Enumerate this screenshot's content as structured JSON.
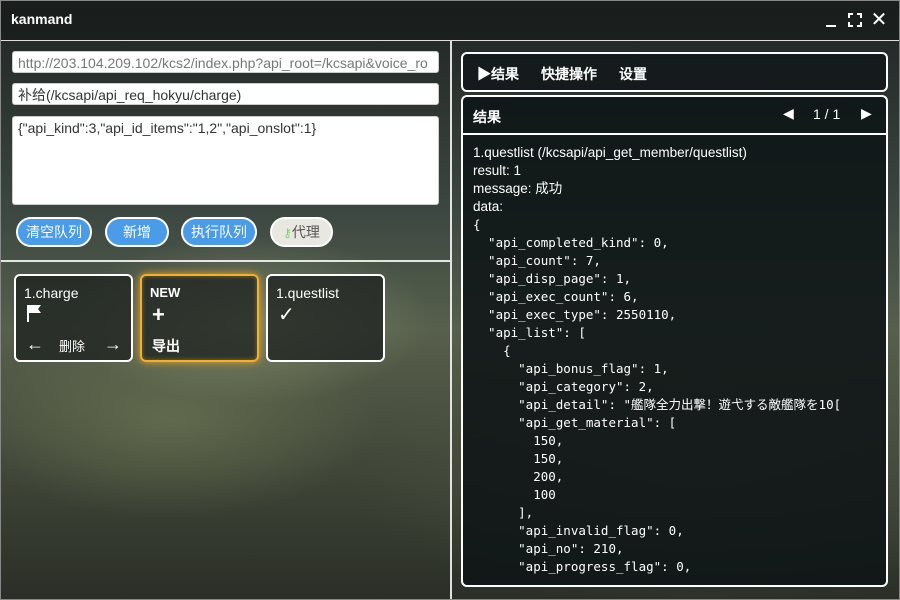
{
  "app": {
    "title": "kanmand"
  },
  "request": {
    "url": "http://203.104.209.102/kcs2/index.php?api_root=/kcsapi&voice_ro",
    "path": "补给(/kcsapi/api_req_hokyu/charge)",
    "body": "{\"api_kind\":3,\"api_id_items\":\"1,2\",\"api_onslot\":1}"
  },
  "buttons": {
    "clear_queue": "清空队列",
    "add": "新增",
    "run_queue": "执行队列",
    "proxy": "代理",
    "proxy_icon": "key-icon"
  },
  "queue": [
    {
      "label": "1.charge",
      "icon": "flag-icon",
      "delete": "删除"
    },
    {
      "label": "NEW",
      "icon": "plus-icon",
      "export": "导出",
      "color": "#f0b030"
    },
    {
      "label": "1.questlist",
      "icon": "check-icon"
    }
  ],
  "menu": {
    "result": "▶结果",
    "quick": "快捷操作",
    "settings": "设置"
  },
  "result": {
    "title": "结果",
    "page": "1 / 1",
    "heading": "1.questlist (/kcsapi/api_get_member/questlist)",
    "result_line": "result: 1",
    "message": "message: 成功",
    "data_label": "data:",
    "json_lines": [
      "{",
      "  \"api_completed_kind\": 0,",
      "  \"api_count\": 7,",
      "  \"api_disp_page\": 1,",
      "  \"api_exec_count\": 6,",
      "  \"api_exec_type\": 2550110,",
      "  \"api_list\": [",
      "    {",
      "      \"api_bonus_flag\": 1,",
      "      \"api_category\": 2,",
      "      \"api_detail\": \"艦隊全力出撃！遊弋する敵艦隊を10[",
      "      \"api_get_material\": [",
      "        150,",
      "        150,",
      "        200,",
      "        100",
      "      ],",
      "      \"api_invalid_flag\": 0,",
      "      \"api_no\": 210,",
      "      \"api_progress_flag\": 0,"
    ]
  },
  "colors": {
    "accent": "#4a9be8",
    "new_border": "#f0b030"
  }
}
